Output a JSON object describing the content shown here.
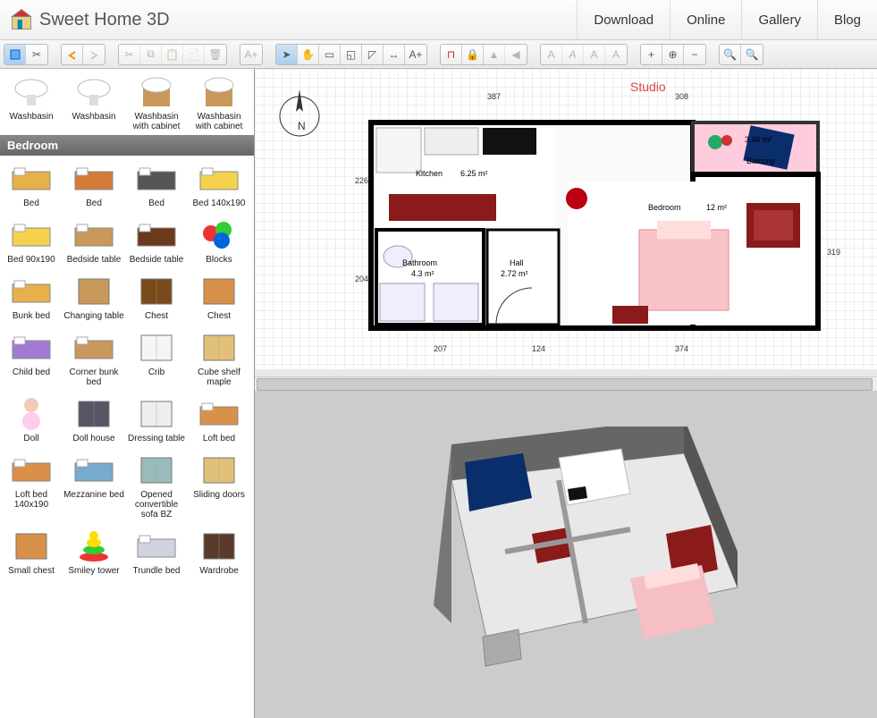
{
  "app": {
    "name": "Sweet Home 3D"
  },
  "nav": {
    "download": "Download",
    "online": "Online",
    "gallery": "Gallery",
    "blog": "Blog"
  },
  "catalog": {
    "bathroom_items": [
      {
        "label": "Washbasin"
      },
      {
        "label": "Washbasin"
      },
      {
        "label": "Washbasin with cabinet"
      },
      {
        "label": "Washbasin with cabinet"
      }
    ],
    "category": "Bedroom",
    "items": [
      "Bed",
      "Bed",
      "Bed",
      "Bed 140x190",
      "Bed 90x190",
      "Bedside table",
      "Bedside table",
      "Blocks",
      "Bunk bed",
      "Changing table",
      "Chest",
      "Chest",
      "Child bed",
      "Corner bunk bed",
      "Crib",
      "Cube shelf maple",
      "Doll",
      "Doll house",
      "Dressing table",
      "Loft bed",
      "Loft bed 140x190",
      "Mezzanine bed",
      "Opened convertible sofa BZ",
      "Sliding doors",
      "Small chest",
      "Smiley tower",
      "Trundle bed",
      "Wardrobe"
    ]
  },
  "plan": {
    "title": "Studio",
    "rooms": [
      {
        "name": "Kitchen",
        "area": "6.25 m²"
      },
      {
        "name": "Bathroom",
        "area": "4.3 m²"
      },
      {
        "name": "Hall",
        "area": "2.72 m²"
      },
      {
        "name": "Bedroom",
        "area": "12 m²"
      },
      {
        "name": "Balcony",
        "area": "3.46 m²"
      }
    ],
    "dims": {
      "top1": "387",
      "top2": "308",
      "left1": "226",
      "left2": "204",
      "bot1": "207",
      "bot2": "124",
      "bot3": "374",
      "right": "319"
    }
  }
}
